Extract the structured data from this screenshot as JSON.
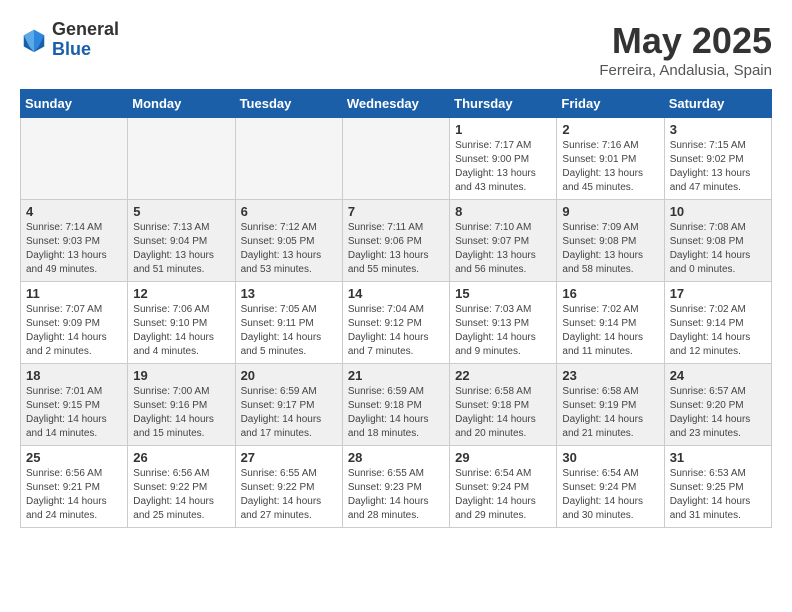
{
  "logo": {
    "general": "General",
    "blue": "Blue"
  },
  "title": {
    "month_year": "May 2025",
    "location": "Ferreira, Andalusia, Spain"
  },
  "headers": [
    "Sunday",
    "Monday",
    "Tuesday",
    "Wednesday",
    "Thursday",
    "Friday",
    "Saturday"
  ],
  "weeks": [
    {
      "shaded": false,
      "days": [
        {
          "num": "",
          "info": ""
        },
        {
          "num": "",
          "info": ""
        },
        {
          "num": "",
          "info": ""
        },
        {
          "num": "",
          "info": ""
        },
        {
          "num": "1",
          "info": "Sunrise: 7:17 AM\nSunset: 9:00 PM\nDaylight: 13 hours\nand 43 minutes."
        },
        {
          "num": "2",
          "info": "Sunrise: 7:16 AM\nSunset: 9:01 PM\nDaylight: 13 hours\nand 45 minutes."
        },
        {
          "num": "3",
          "info": "Sunrise: 7:15 AM\nSunset: 9:02 PM\nDaylight: 13 hours\nand 47 minutes."
        }
      ]
    },
    {
      "shaded": true,
      "days": [
        {
          "num": "4",
          "info": "Sunrise: 7:14 AM\nSunset: 9:03 PM\nDaylight: 13 hours\nand 49 minutes."
        },
        {
          "num": "5",
          "info": "Sunrise: 7:13 AM\nSunset: 9:04 PM\nDaylight: 13 hours\nand 51 minutes."
        },
        {
          "num": "6",
          "info": "Sunrise: 7:12 AM\nSunset: 9:05 PM\nDaylight: 13 hours\nand 53 minutes."
        },
        {
          "num": "7",
          "info": "Sunrise: 7:11 AM\nSunset: 9:06 PM\nDaylight: 13 hours\nand 55 minutes."
        },
        {
          "num": "8",
          "info": "Sunrise: 7:10 AM\nSunset: 9:07 PM\nDaylight: 13 hours\nand 56 minutes."
        },
        {
          "num": "9",
          "info": "Sunrise: 7:09 AM\nSunset: 9:08 PM\nDaylight: 13 hours\nand 58 minutes."
        },
        {
          "num": "10",
          "info": "Sunrise: 7:08 AM\nSunset: 9:08 PM\nDaylight: 14 hours\nand 0 minutes."
        }
      ]
    },
    {
      "shaded": false,
      "days": [
        {
          "num": "11",
          "info": "Sunrise: 7:07 AM\nSunset: 9:09 PM\nDaylight: 14 hours\nand 2 minutes."
        },
        {
          "num": "12",
          "info": "Sunrise: 7:06 AM\nSunset: 9:10 PM\nDaylight: 14 hours\nand 4 minutes."
        },
        {
          "num": "13",
          "info": "Sunrise: 7:05 AM\nSunset: 9:11 PM\nDaylight: 14 hours\nand 5 minutes."
        },
        {
          "num": "14",
          "info": "Sunrise: 7:04 AM\nSunset: 9:12 PM\nDaylight: 14 hours\nand 7 minutes."
        },
        {
          "num": "15",
          "info": "Sunrise: 7:03 AM\nSunset: 9:13 PM\nDaylight: 14 hours\nand 9 minutes."
        },
        {
          "num": "16",
          "info": "Sunrise: 7:02 AM\nSunset: 9:14 PM\nDaylight: 14 hours\nand 11 minutes."
        },
        {
          "num": "17",
          "info": "Sunrise: 7:02 AM\nSunset: 9:14 PM\nDaylight: 14 hours\nand 12 minutes."
        }
      ]
    },
    {
      "shaded": true,
      "days": [
        {
          "num": "18",
          "info": "Sunrise: 7:01 AM\nSunset: 9:15 PM\nDaylight: 14 hours\nand 14 minutes."
        },
        {
          "num": "19",
          "info": "Sunrise: 7:00 AM\nSunset: 9:16 PM\nDaylight: 14 hours\nand 15 minutes."
        },
        {
          "num": "20",
          "info": "Sunrise: 6:59 AM\nSunset: 9:17 PM\nDaylight: 14 hours\nand 17 minutes."
        },
        {
          "num": "21",
          "info": "Sunrise: 6:59 AM\nSunset: 9:18 PM\nDaylight: 14 hours\nand 18 minutes."
        },
        {
          "num": "22",
          "info": "Sunrise: 6:58 AM\nSunset: 9:18 PM\nDaylight: 14 hours\nand 20 minutes."
        },
        {
          "num": "23",
          "info": "Sunrise: 6:58 AM\nSunset: 9:19 PM\nDaylight: 14 hours\nand 21 minutes."
        },
        {
          "num": "24",
          "info": "Sunrise: 6:57 AM\nSunset: 9:20 PM\nDaylight: 14 hours\nand 23 minutes."
        }
      ]
    },
    {
      "shaded": false,
      "days": [
        {
          "num": "25",
          "info": "Sunrise: 6:56 AM\nSunset: 9:21 PM\nDaylight: 14 hours\nand 24 minutes."
        },
        {
          "num": "26",
          "info": "Sunrise: 6:56 AM\nSunset: 9:22 PM\nDaylight: 14 hours\nand 25 minutes."
        },
        {
          "num": "27",
          "info": "Sunrise: 6:55 AM\nSunset: 9:22 PM\nDaylight: 14 hours\nand 27 minutes."
        },
        {
          "num": "28",
          "info": "Sunrise: 6:55 AM\nSunset: 9:23 PM\nDaylight: 14 hours\nand 28 minutes."
        },
        {
          "num": "29",
          "info": "Sunrise: 6:54 AM\nSunset: 9:24 PM\nDaylight: 14 hours\nand 29 minutes."
        },
        {
          "num": "30",
          "info": "Sunrise: 6:54 AM\nSunset: 9:24 PM\nDaylight: 14 hours\nand 30 minutes."
        },
        {
          "num": "31",
          "info": "Sunrise: 6:53 AM\nSunset: 9:25 PM\nDaylight: 14 hours\nand 31 minutes."
        }
      ]
    }
  ]
}
